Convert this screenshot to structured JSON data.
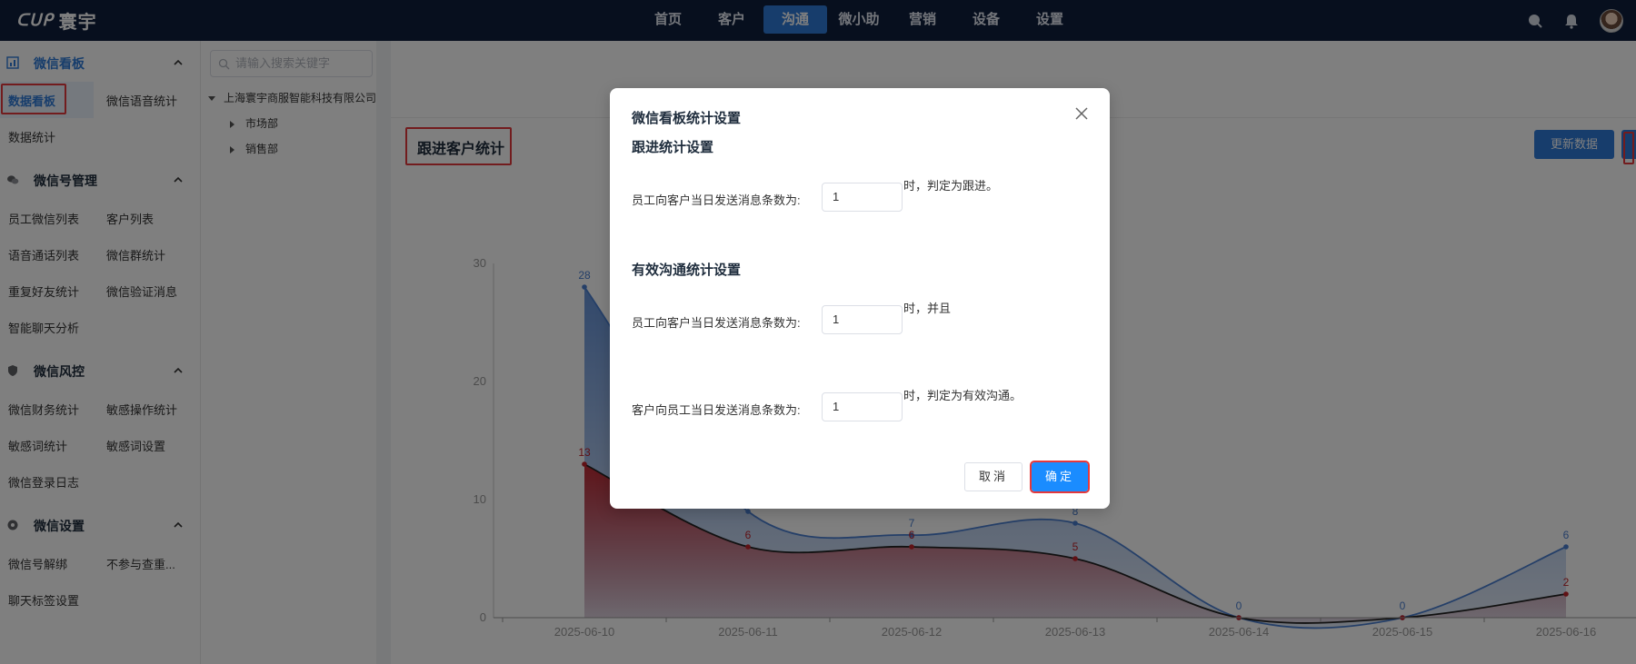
{
  "app": {
    "logo_mark": "ᑕᑌᑭ",
    "logo_text": "寰宇"
  },
  "nav": {
    "items": [
      "首页",
      "客户",
      "沟通",
      "微小助",
      "营销",
      "设备",
      "设置"
    ],
    "active_index": 2
  },
  "sidebar": {
    "sections": [
      {
        "title": "微信看板",
        "items": [
          "数据看板",
          "微信语音统计",
          "数据统计"
        ]
      },
      {
        "title": "微信号管理",
        "items": [
          "员工微信列表",
          "客户列表",
          "语音通话列表",
          "微信群统计",
          "重复好友统计",
          "微信验证消息",
          "智能聊天分析"
        ]
      },
      {
        "title": "微信风控",
        "items": [
          "微信财务统计",
          "敏感操作统计",
          "敏感词统计",
          "敏感词设置",
          "微信登录日志"
        ]
      },
      {
        "title": "微信设置",
        "items": [
          "微信号解绑",
          "不参与查重...",
          "聊天标签设置"
        ]
      }
    ],
    "active_item": "数据看板"
  },
  "tree": {
    "search_placeholder": "请输入搜索关键字",
    "root": "上海寰宇商服智能科技有限公司",
    "children": [
      "市场部",
      "销售部"
    ]
  },
  "main": {
    "section_title": "跟进客户统计",
    "update_button": "更新数据"
  },
  "chart_data": {
    "type": "area",
    "categories": [
      "2025-06-10",
      "2025-06-11",
      "2025-06-12",
      "2025-06-13",
      "2025-06-14",
      "2025-06-15",
      "2025-06-16"
    ],
    "series": [
      {
        "values": [
          28,
          9,
          7,
          8,
          0,
          0,
          6
        ],
        "labels": [
          "28",
          "",
          "7",
          "8",
          "0",
          "0",
          "6"
        ],
        "color": "#4a7fd1"
      },
      {
        "values": [
          13,
          6,
          6,
          5,
          0,
          0,
          2
        ],
        "labels": [
          "13",
          "6",
          "6",
          "5",
          "",
          "",
          "2"
        ],
        "color": "#c0232a"
      }
    ],
    "yticks": [
      "0",
      "10",
      "20",
      "30"
    ],
    "ylim": [
      0,
      30
    ]
  },
  "modal": {
    "title": "微信看板统计设置",
    "follow_section": "跟进统计设置",
    "follow_label": "员工向客户当日发送消息条数为:",
    "follow_value": "1",
    "follow_suffix": "时，判定为跟进。",
    "effective_section": "有效沟通统计设置",
    "eff_label1": "员工向客户当日发送消息条数为:",
    "eff_value1": "1",
    "eff_suffix1": "时，并且",
    "eff_label2": "客户向员工当日发送消息条数为:",
    "eff_value2": "1",
    "eff_suffix2": "时，判定为有效沟通。",
    "cancel": "取消",
    "confirm": "确定"
  }
}
